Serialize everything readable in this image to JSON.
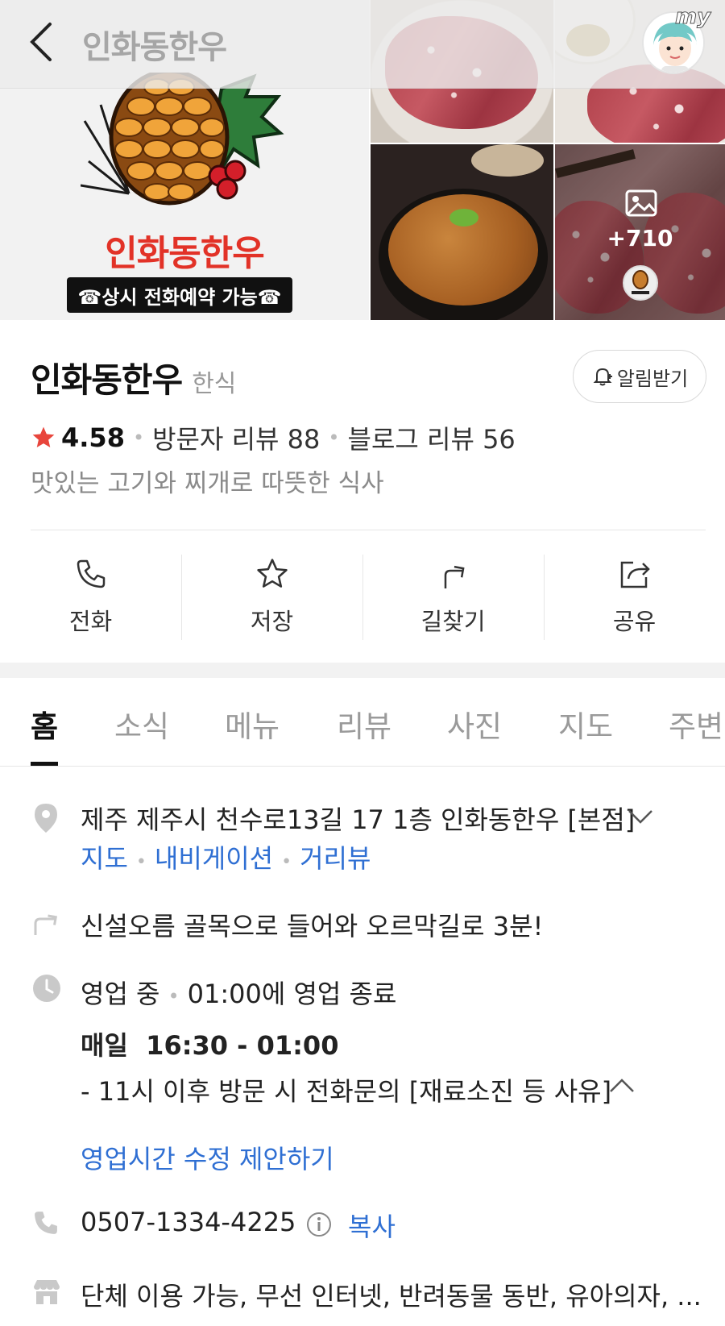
{
  "header": {
    "title": "인화동한우",
    "my_label": "my",
    "logo_name": "인화동한우",
    "logo_banner": "☎상시 전화예약 가능☎",
    "more_photos": "+710"
  },
  "place": {
    "name": "인화동한우",
    "category": "한식",
    "alarm_label": "알림받기",
    "rating": "4.58",
    "visitor_reviews": "방문자 리뷰 88",
    "blog_reviews": "블로그 리뷰 56",
    "description": "맛있는 고기와 찌개로 따뜻한 식사"
  },
  "actions": [
    {
      "label": "전화",
      "icon": "phone-icon"
    },
    {
      "label": "저장",
      "icon": "star-icon"
    },
    {
      "label": "길찾기",
      "icon": "directions-icon"
    },
    {
      "label": "공유",
      "icon": "share-icon"
    }
  ],
  "tabs": [
    "홈",
    "소식",
    "메뉴",
    "리뷰",
    "사진",
    "지도",
    "주변"
  ],
  "details": {
    "address": "제주 제주시 천수로13길 17 1층 인화동한우 [본점]",
    "address_links": [
      "지도",
      "내비게이션",
      "거리뷰"
    ],
    "directions": "신설오름 골목으로 들어와 오르막길로 3분!",
    "hours_status": "영업 중",
    "hours_close": "01:00에 영업 종료",
    "hours_day": "매일",
    "hours_time": "16:30 - 01:00",
    "hours_note": "- 11시 이후 방문 시 전화문의 [재료소진 등 사유]",
    "hours_edit_link": "영업시간 수정 제안하기",
    "phone": "0507-1334-4225",
    "copy_label": "복사",
    "amenities": "단체 이용 가능, 무선 인터넷, 반려동물 동반, 유아의자, ..."
  },
  "colors": {
    "star": "#e8453c",
    "link": "#2f6fd3",
    "brand_red": "#e23227"
  }
}
